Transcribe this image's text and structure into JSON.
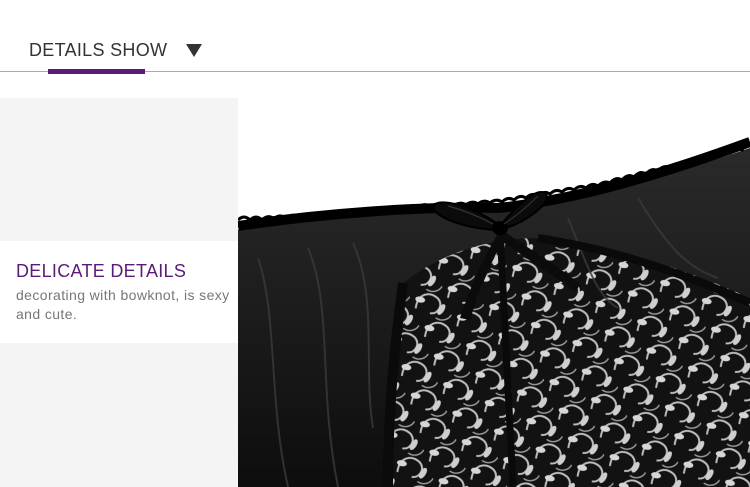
{
  "header": {
    "title": "DETAILS SHOW",
    "arrow_icon": "triangle-down-icon",
    "accent_color": "#5b1a7a"
  },
  "caption": {
    "title": "DELICATE DETAILS",
    "description": "decorating with bowknot, is sexy and cute.",
    "title_color": "#5b1a7a"
  },
  "photo": {
    "subject": "black-lace-garment-closeup"
  }
}
